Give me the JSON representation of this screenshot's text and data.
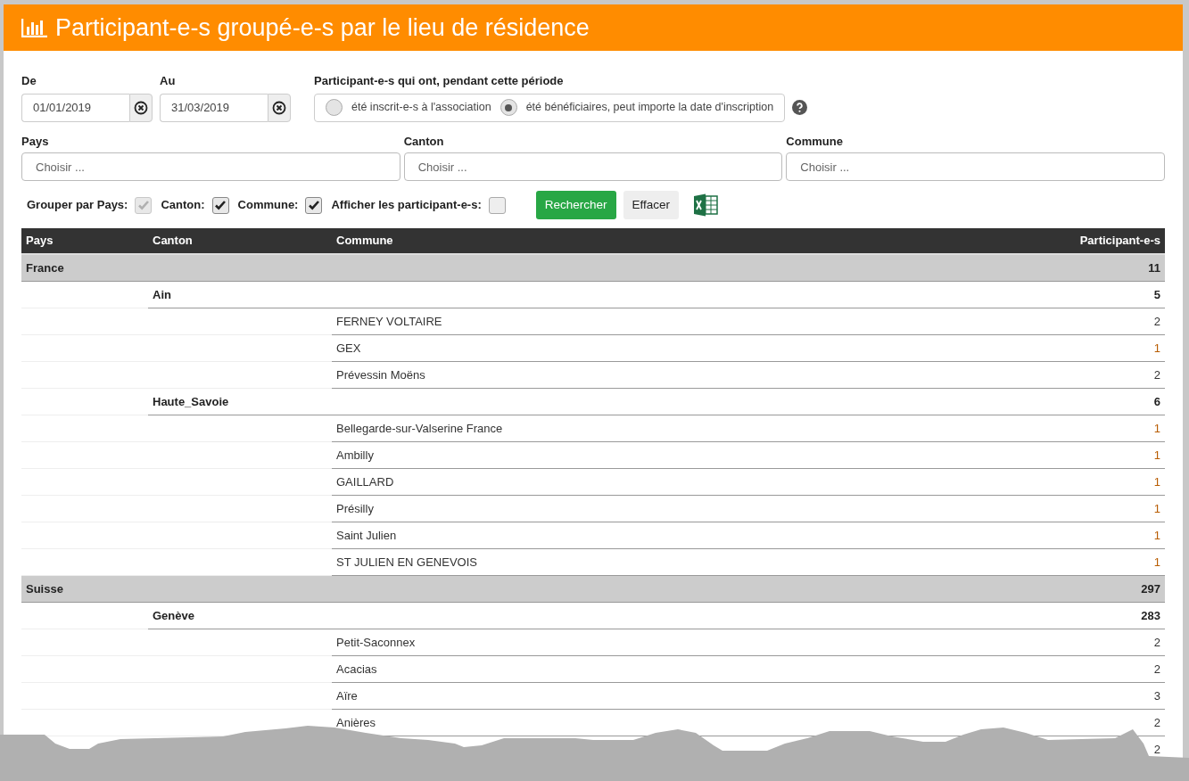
{
  "title": "Participant-e-s groupé-e-s par le lieu de résidence",
  "dates": [
    {
      "label": "De",
      "value": "01/01/2019"
    },
    {
      "label": "Au",
      "value": "31/03/2019"
    }
  ],
  "period": {
    "label": "Participant-e-s qui ont, pendant cette période",
    "options": [
      {
        "label": "été inscrit-e-s à l'association",
        "selected": false
      },
      {
        "label": "été bénéficiaires, peut importe la date d'inscription",
        "selected": true
      }
    ]
  },
  "filters": [
    {
      "label": "Pays",
      "placeholder": "Choisir ..."
    },
    {
      "label": "Canton",
      "placeholder": "Choisir ..."
    },
    {
      "label": "Commune",
      "placeholder": "Choisir ..."
    }
  ],
  "grouping": [
    {
      "label": "Grouper par Pays:",
      "checked": true,
      "disabled": true
    },
    {
      "label": "Canton:",
      "checked": true,
      "disabled": false
    },
    {
      "label": "Commune:",
      "checked": true,
      "disabled": false
    },
    {
      "label": "Afficher les participant-e-s:",
      "checked": false,
      "disabled": false
    }
  ],
  "buttons": {
    "search": "Rechercher",
    "clear": "Effacer"
  },
  "table": {
    "columns": [
      "Pays",
      "Canton",
      "Commune",
      "Participant-e-s"
    ],
    "rows": [
      {
        "name": "France",
        "count": "11",
        "children": [
          {
            "name": "Ain",
            "count": "5",
            "children": [
              {
                "name": "FERNEY VOLTAIRE",
                "count": "2",
                "highlighted": false
              },
              {
                "name": "GEX",
                "count": "1",
                "highlighted": true
              },
              {
                "name": "Prévessin Moëns",
                "count": "2",
                "highlighted": false
              }
            ]
          },
          {
            "name": "Haute_Savoie",
            "count": "6",
            "children": [
              {
                "name": "Bellegarde-sur-Valserine France",
                "count": "1",
                "highlighted": true
              },
              {
                "name": "Ambilly",
                "count": "1",
                "highlighted": true
              },
              {
                "name": "GAILLARD",
                "count": "1",
                "highlighted": true
              },
              {
                "name": "Présilly",
                "count": "1",
                "highlighted": true
              },
              {
                "name": "Saint Julien",
                "count": "1",
                "highlighted": true
              },
              {
                "name": "ST JULIEN EN GENEVOIS",
                "count": "1",
                "highlighted": true
              }
            ]
          }
        ]
      },
      {
        "name": "Suisse",
        "count": "297",
        "children": [
          {
            "name": "Genève",
            "count": "283",
            "children": [
              {
                "name": "Petit-Saconnex",
                "count": "2",
                "highlighted": false
              },
              {
                "name": "Acacias",
                "count": "2",
                "highlighted": false
              },
              {
                "name": "Aïre",
                "count": "3",
                "highlighted": false
              },
              {
                "name": "Anières",
                "count": "2",
                "highlighted": false
              },
              {
                "count": "2",
                "highlighted": false
              }
            ]
          }
        ]
      }
    ]
  }
}
